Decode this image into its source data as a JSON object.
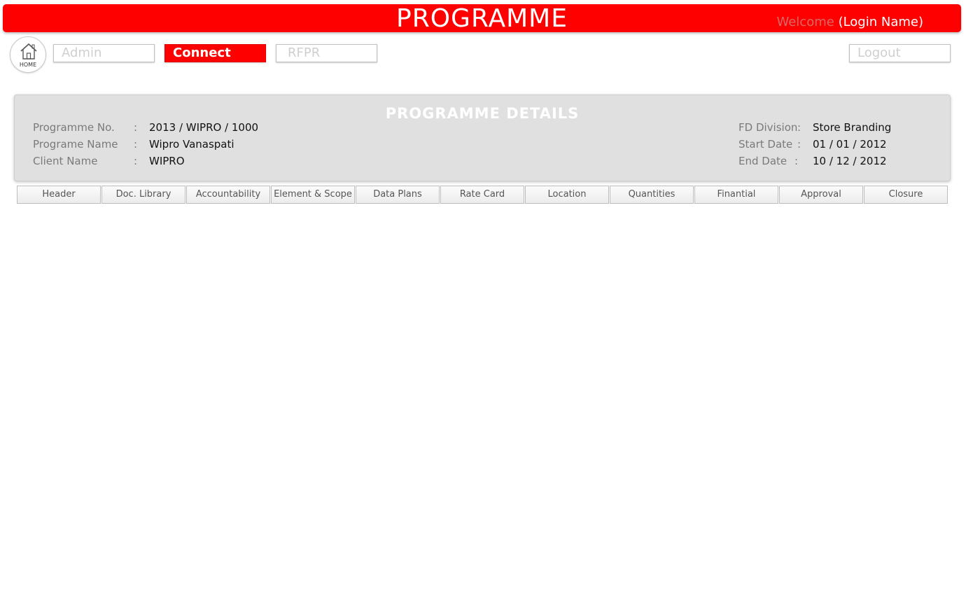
{
  "header": {
    "title": "PROGRAMME",
    "welcome_label": "Welcome",
    "login_name": "(Login Name)"
  },
  "nav": {
    "home_label": "HOME",
    "admin": "Admin",
    "connect": "Connect",
    "rfpr": "RFPR",
    "logout": "Logout"
  },
  "details": {
    "title": "PROGRAMME  DETAILS",
    "programme_no_label": "Programme  No.",
    "programme_no_value": "2013 / WIPRO / 1000",
    "programme_name_label": "Programe Name",
    "programme_name_value": "Wipro Vanaspati",
    "client_name_label": "Client  Name",
    "client_name_value": "WIPRO",
    "fd_division_label": "FD Division",
    "fd_division_value": "Store Branding",
    "start_date_label": "Start Date",
    "start_date_value": "01 / 01 / 2012",
    "end_date_label": "End Date",
    "end_date_value": "10 / 12 / 2012",
    "colon": ":"
  },
  "tabs": [
    {
      "label": "Header"
    },
    {
      "label": "Doc. Library"
    },
    {
      "label": "Accountability"
    },
    {
      "label": "Element & Scope"
    },
    {
      "label": "Data Plans"
    },
    {
      "label": "Rate Card"
    },
    {
      "label": "Location"
    },
    {
      "label": "Quantities"
    },
    {
      "label": "Finantial"
    },
    {
      "label": "Approval"
    },
    {
      "label": "Closure"
    }
  ],
  "colors": {
    "brand_red": "#ff0000",
    "panel_gray": "#e0e0e0"
  }
}
